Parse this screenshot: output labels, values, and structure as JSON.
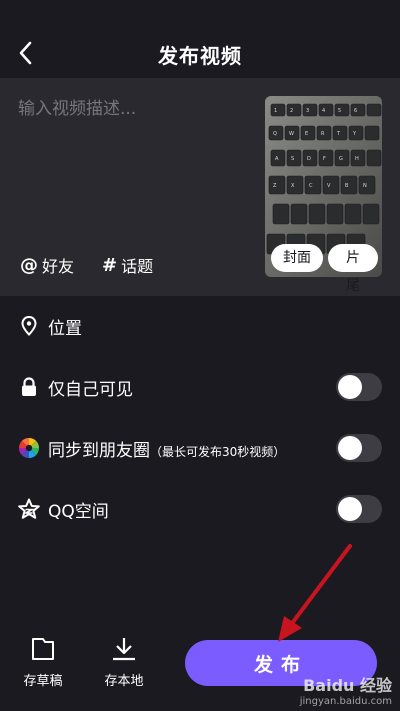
{
  "header": {
    "title": "发布视频"
  },
  "compose": {
    "placeholder": "输入视频描述...",
    "friend_tag": "好友",
    "topic_tag": "话题",
    "cover_label": "封面",
    "ending_label": "片尾"
  },
  "settings": {
    "location": "位置",
    "private": {
      "label": "仅自己可见",
      "enabled": false
    },
    "moments": {
      "label": "同步到朋友圈",
      "note": "（最长可发布30秒视频）",
      "enabled": false
    },
    "qzone": {
      "label": "QQ空间",
      "enabled": false
    }
  },
  "bottom": {
    "draft_label": "存草稿",
    "save_local_label": "存本地",
    "publish_label": "发布"
  },
  "watermark": {
    "brand": "Baidu 经验",
    "url": "jingyan.baidu.com"
  },
  "colors": {
    "background": "#1b1a20",
    "panel": "#2a292f",
    "accent": "#7a5cff",
    "arrow": "#c8141e"
  }
}
